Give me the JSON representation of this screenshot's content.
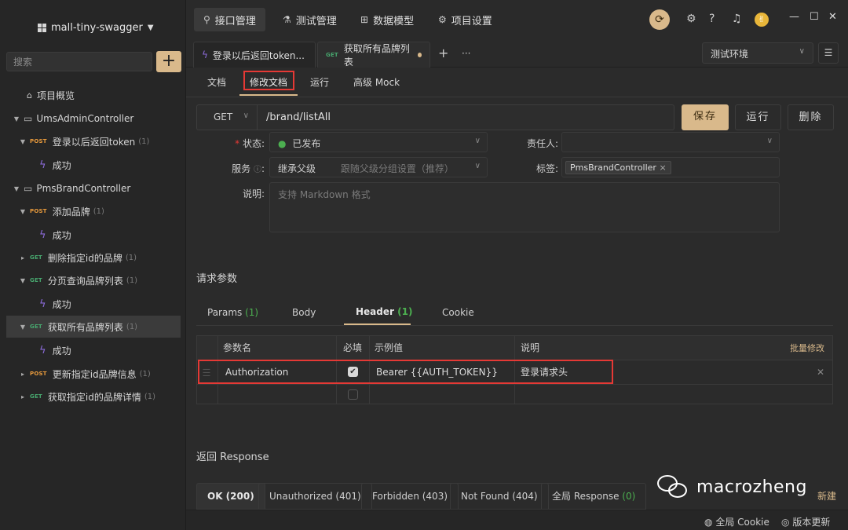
{
  "sidebar": {
    "project_name": "mall-tiny-swagger",
    "search_placeholder": "搜索",
    "add_label": "+",
    "tree": [
      {
        "label": "项目概览"
      },
      {
        "label": "UmsAdminController"
      },
      {
        "method": "POST",
        "label": "登录以后返回token",
        "count": "(1)"
      },
      {
        "label": "成功"
      },
      {
        "label": "PmsBrandController"
      },
      {
        "method": "POST",
        "label": "添加品牌",
        "count": "(1)"
      },
      {
        "label": "成功"
      },
      {
        "method": "GET",
        "label": "删除指定id的品牌",
        "count": "(1)"
      },
      {
        "method": "GET",
        "label": "分页查询品牌列表",
        "count": "(1)"
      },
      {
        "label": "成功"
      },
      {
        "method": "GET",
        "label": "获取所有品牌列表",
        "count": "(1)"
      },
      {
        "label": "成功"
      },
      {
        "method": "POST",
        "label": "更新指定id品牌信息",
        "count": "(1)"
      },
      {
        "method": "GET",
        "label": "获取指定id的品牌详情",
        "count": "(1)"
      }
    ]
  },
  "topnav": [
    "接口管理",
    "测试管理",
    "数据模型",
    "项目设置"
  ],
  "tabs": {
    "tab1": "登录以后返回token...",
    "tab2_method": "GET",
    "tab2": "获取所有品牌列表",
    "plus": "+",
    "more": "···",
    "env": "测试环境"
  },
  "subtabs": [
    "文档",
    "修改文档",
    "运行",
    "高级 Mock"
  ],
  "request": {
    "method": "GET",
    "url": "/brand/listAll",
    "save": "保存",
    "run": "运行",
    "delete": "删除"
  },
  "form": {
    "status_label": "状态:",
    "status_value": "已发布",
    "owner_label": "责任人:",
    "service_label": "服务",
    "service_value": "继承父级",
    "service_hint": "跟随父级分组设置（推荐）",
    "tag_label": "标签:",
    "tag_value": "PmsBrandController",
    "desc_label": "说明:",
    "desc_placeholder": "支持 Markdown 格式"
  },
  "params": {
    "section_title": "请求参数",
    "tabs": [
      {
        "label": "Params",
        "count": "(1)"
      },
      {
        "label": "Body",
        "count": ""
      },
      {
        "label": "Header",
        "count": "(1)"
      },
      {
        "label": "Cookie",
        "count": ""
      }
    ],
    "columns": [
      "参数名",
      "必填",
      "示例值",
      "说明"
    ],
    "bulk_edit": "批量修改",
    "rows": [
      {
        "name": "Authorization",
        "required": true,
        "example": "Bearer {{AUTH_TOKEN}}",
        "desc": "登录请求头"
      }
    ]
  },
  "response": {
    "section_title": "返回 Response",
    "tabs": [
      {
        "label": "OK (200)",
        "count": ""
      },
      {
        "label": "Unauthorized (401)",
        "count": ""
      },
      {
        "label": "Forbidden (403)",
        "count": ""
      },
      {
        "label": "Not Found (404)",
        "count": ""
      },
      {
        "label": "全局 Response",
        "count": "(0)"
      }
    ],
    "new_link": "新建"
  },
  "watermark": "macrozheng",
  "status": {
    "cookie": "全局 Cookie",
    "update": "版本更新"
  }
}
